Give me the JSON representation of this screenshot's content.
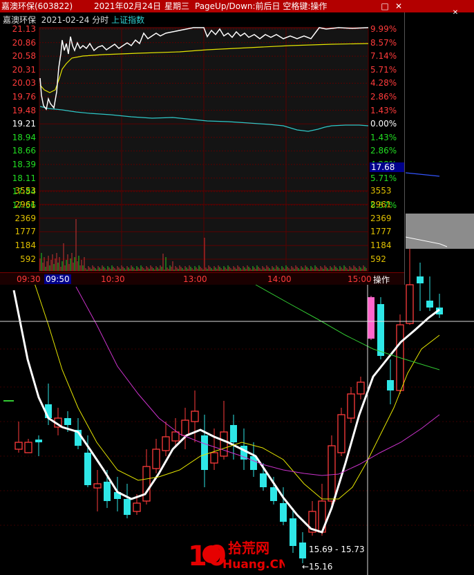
{
  "window": {
    "stock_name": "嘉澳环保",
    "stock_code": "(603822)",
    "date_text": "2021年02月24日",
    "weekday": "星期三",
    "hint": "PageUp/Down:前后日 空格键:操作",
    "minimize_glyph": "□",
    "close_glyph": "✕"
  },
  "intraday": {
    "header_name": "嘉澳环保",
    "header_date": "2021-02-24",
    "header_mode": "分时",
    "header_index": "上证指数",
    "price_labels": [
      "21.13",
      "20.86",
      "20.58",
      "20.31",
      "20.03",
      "19.76",
      "19.48",
      "19.21",
      "18.94",
      "18.66",
      "18.39",
      "18.11",
      "17.84",
      "17.56"
    ],
    "pct_labels": [
      "9.99%",
      "8.57%",
      "7.14%",
      "5.71%",
      "4.28%",
      "2.86%",
      "1.43%",
      "0.00%",
      "1.43%",
      "2.86%",
      "4.28%",
      "5.71%",
      "",
      "8.57%"
    ],
    "index_price_box": "17.68",
    "volume_labels": [
      "3553",
      "2961",
      "2369",
      "1777",
      "1184",
      "592"
    ],
    "time_labels": [
      "09:30",
      "09:50",
      "10:30",
      "13:00",
      "14:00",
      "15:00"
    ],
    "selected_time": "09:50",
    "operate_button": "操作",
    "colors": {
      "price_line": "#ffffff",
      "avg_line": "#e6e600",
      "index_line": "#2fc8c8",
      "volume": "#cc3333"
    }
  },
  "kline": {
    "annotations": {
      "range_text": "15.69 - 15.73",
      "low_text": "←15.16"
    },
    "colors": {
      "up": "#ff3b3b",
      "down": "#2ee6e6",
      "ma5": "#ffffff",
      "ma10": "#e6e600",
      "ma20": "#cc33cc",
      "ma60": "#33cc33",
      "highlight": "#ff66cc"
    }
  },
  "watermark": {
    "number": "10",
    "cn": "拾荒网",
    "en": "Huang.CN"
  }
}
